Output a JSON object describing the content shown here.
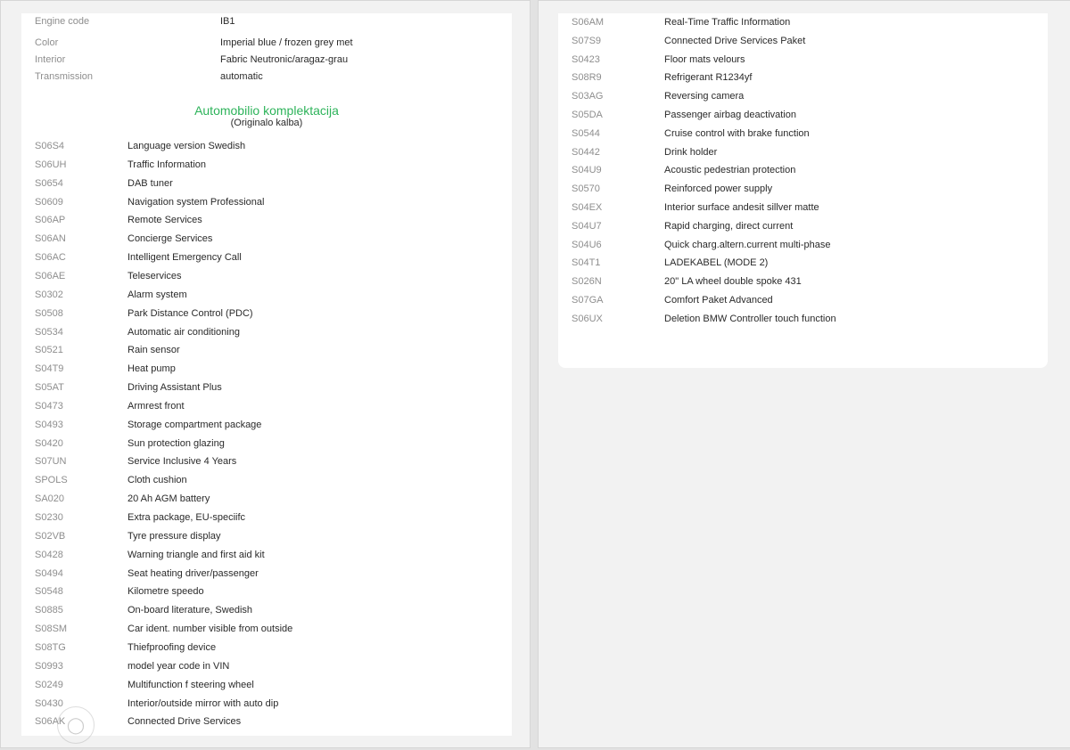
{
  "vehicle_info": {
    "engine_code": {
      "label": "Engine code",
      "value": "IB1"
    },
    "color": {
      "label": "Color",
      "value": "Imperial blue / frozen grey met"
    },
    "interior": {
      "label": "Interior",
      "value": "Fabric Neutronic/aragaz-grau"
    },
    "transmission": {
      "label": "Transmission",
      "value": "automatic"
    }
  },
  "section": {
    "title": "Automobilio komplektacija",
    "subtitle": "(Originalo kalba)"
  },
  "options_left": [
    {
      "code": "S06S4",
      "label": "Language version Swedish"
    },
    {
      "code": "S06UH",
      "label": "Traffic Information"
    },
    {
      "code": "S0654",
      "label": "DAB tuner"
    },
    {
      "code": "S0609",
      "label": "Navigation system Professional"
    },
    {
      "code": "S06AP",
      "label": "Remote Services"
    },
    {
      "code": "S06AN",
      "label": "Concierge Services"
    },
    {
      "code": "S06AC",
      "label": "Intelligent Emergency Call"
    },
    {
      "code": "S06AE",
      "label": "Teleservices"
    },
    {
      "code": "S0302",
      "label": "Alarm system"
    },
    {
      "code": "S0508",
      "label": "Park Distance Control (PDC)"
    },
    {
      "code": "S0534",
      "label": "Automatic air conditioning"
    },
    {
      "code": "S0521",
      "label": "Rain sensor"
    },
    {
      "code": "S04T9",
      "label": "Heat pump"
    },
    {
      "code": "S05AT",
      "label": "Driving Assistant Plus"
    },
    {
      "code": "S0473",
      "label": "Armrest front"
    },
    {
      "code": "S0493",
      "label": "Storage compartment package"
    },
    {
      "code": "S0420",
      "label": "Sun protection glazing"
    },
    {
      "code": "S07UN",
      "label": "Service Inclusive 4 Years"
    },
    {
      "code": "SPOLS",
      "label": "Cloth cushion"
    },
    {
      "code": "SA020",
      "label": "20 Ah AGM battery"
    },
    {
      "code": "S0230",
      "label": "Extra package, EU-speciifc"
    },
    {
      "code": "S02VB",
      "label": "Tyre pressure display"
    },
    {
      "code": "S0428",
      "label": "Warning triangle and first aid kit"
    },
    {
      "code": "S0494",
      "label": "Seat heating driver/passenger"
    },
    {
      "code": "S0548",
      "label": "Kilometre speedo"
    },
    {
      "code": "S0885",
      "label": "On-board literature, Swedish"
    },
    {
      "code": "S08SM",
      "label": "Car ident. number visible from outside"
    },
    {
      "code": "S08TG",
      "label": "Thiefproofing device"
    },
    {
      "code": "S0993",
      "label": "model year code in VIN"
    },
    {
      "code": "S0249",
      "label": "Multifunction f steering wheel"
    },
    {
      "code": "S0430",
      "label": "Interior/outside mirror with auto dip"
    },
    {
      "code": "S06AK",
      "label": "Connected Drive Services"
    }
  ],
  "options_right": [
    {
      "code": "S06AM",
      "label": "Real-Time Traffic Information"
    },
    {
      "code": "S07S9",
      "label": "Connected Drive Services Paket"
    },
    {
      "code": "S0423",
      "label": "Floor mats velours"
    },
    {
      "code": "S08R9",
      "label": "Refrigerant R1234yf"
    },
    {
      "code": "S03AG",
      "label": "Reversing camera"
    },
    {
      "code": "S05DA",
      "label": "Passenger airbag deactivation"
    },
    {
      "code": "S0544",
      "label": "Cruise control with brake function"
    },
    {
      "code": "S0442",
      "label": "Drink holder"
    },
    {
      "code": "S04U9",
      "label": "Acoustic pedestrian protection"
    },
    {
      "code": "S0570",
      "label": "Reinforced power supply"
    },
    {
      "code": "S04EX",
      "label": "Interior surface andesit sillver matte"
    },
    {
      "code": "S04U7",
      "label": "Rapid charging, direct current"
    },
    {
      "code": "S04U6",
      "label": "Quick charg.altern.current multi-phase"
    },
    {
      "code": "S04T1",
      "label": "LADEKABEL (MODE 2)"
    },
    {
      "code": "S026N",
      "label": "20\" LA wheel double spoke 431"
    },
    {
      "code": "S07GA",
      "label": "Comfort Paket Advanced"
    },
    {
      "code": "S06UX",
      "label": "Deletion BMW Controller touch function"
    }
  ],
  "colors": {
    "accent": "#2db35a",
    "muted": "#8e8e8e",
    "text": "#2a2a2a"
  }
}
